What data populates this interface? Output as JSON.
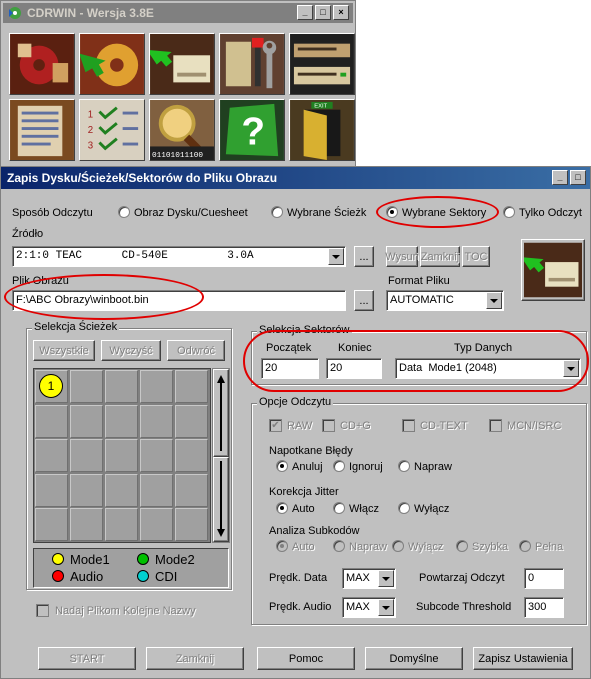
{
  "toolbar_window": {
    "title": "CDRWIN - Wersja 3.8E",
    "controls": [
      "_",
      "□",
      "×"
    ],
    "tools": [
      "record-disc",
      "extract-disc",
      "extract-image",
      "settings-tools",
      "cd-drive",
      "table-of-contents",
      "checklist",
      "search-binary",
      "help",
      "exit"
    ],
    "binary_label": "01101011100",
    "exit_label": "EXIT"
  },
  "dialog": {
    "title": "Zapis Dysku/Ścieżek/Sektorów do Pliku Obrazu",
    "read_mode": {
      "label": "Sposób Odczytu",
      "options": [
        "Obraz Dysku/Cuesheet",
        "Wybrane Ścieżk",
        "Wybrane Sektory",
        "Tylko Odczyt"
      ],
      "selected": 2
    },
    "source": {
      "label": "Źródło",
      "value": "2:1:0 TEAC      CD-540E         3.0A",
      "browse": "...",
      "eject": "Wysuń",
      "close": "Zamknij",
      "toc": "TOC"
    },
    "image_file": {
      "label": "Plik Obrazu",
      "value": "F:\\ABC Obrazy\\winboot.bin",
      "browse": "..."
    },
    "file_format": {
      "label": "Format Pliku",
      "value": "AUTOMATIC"
    },
    "track_selection": {
      "title": "Selekcja Ścieżek",
      "all": "Wszystkie",
      "clear": "Wyczyść",
      "invert": "Odwróć",
      "track_number": "1",
      "legend": [
        {
          "label": "Mode1",
          "color": "#ffff00"
        },
        {
          "label": "Mode2",
          "color": "#00c000"
        },
        {
          "label": "Audio",
          "color": "#ff0000"
        },
        {
          "label": "CDI",
          "color": "#00d0d0"
        }
      ],
      "sequential_names": "Nadaj Plikom Kolejne Nazwy"
    },
    "sector_selection": {
      "title": "Selekcja Sektorów",
      "start_label": "Początek",
      "end_label": "Koniec",
      "type_label": "Typ Danych",
      "start": "20",
      "end": "20",
      "type": "Data  Mode1 (2048)"
    },
    "read_options": {
      "title": "Opcje Odczytu",
      "checks": [
        {
          "label": "RAW",
          "checked": true
        },
        {
          "label": "CD+G",
          "checked": false
        },
        {
          "label": "CD-TEXT",
          "checked": false
        },
        {
          "label": "MCN/ISRC",
          "checked": false
        }
      ],
      "errors": {
        "label": "Napotkane Błędy",
        "options": [
          "Anuluj",
          "Ignoruj",
          "Napraw"
        ],
        "selected": 0
      },
      "jitter": {
        "label": "Korekcja Jitter",
        "options": [
          "Auto",
          "Włącz",
          "Wyłącz"
        ],
        "selected": 0
      },
      "subcode": {
        "label": "Analiza Subkodów",
        "options": [
          "Auto",
          "Napraw",
          "Wyłącz",
          "Szybka",
          "Pełna"
        ],
        "selected": 0
      },
      "data_speed_label": "Prędk. Data",
      "data_speed": "MAX",
      "audio_speed_label": "Prędk. Audio",
      "audio_speed": "MAX",
      "repeat_label": "Powtarzaj Odczyt",
      "repeat": "0",
      "threshold_label": "Subcode Threshold",
      "threshold": "300"
    },
    "buttons": {
      "start": "START",
      "close": "Zamknij",
      "help": "Pomoc",
      "defaults": "Domyślne",
      "save": "Zapisz Ustawienia"
    }
  }
}
